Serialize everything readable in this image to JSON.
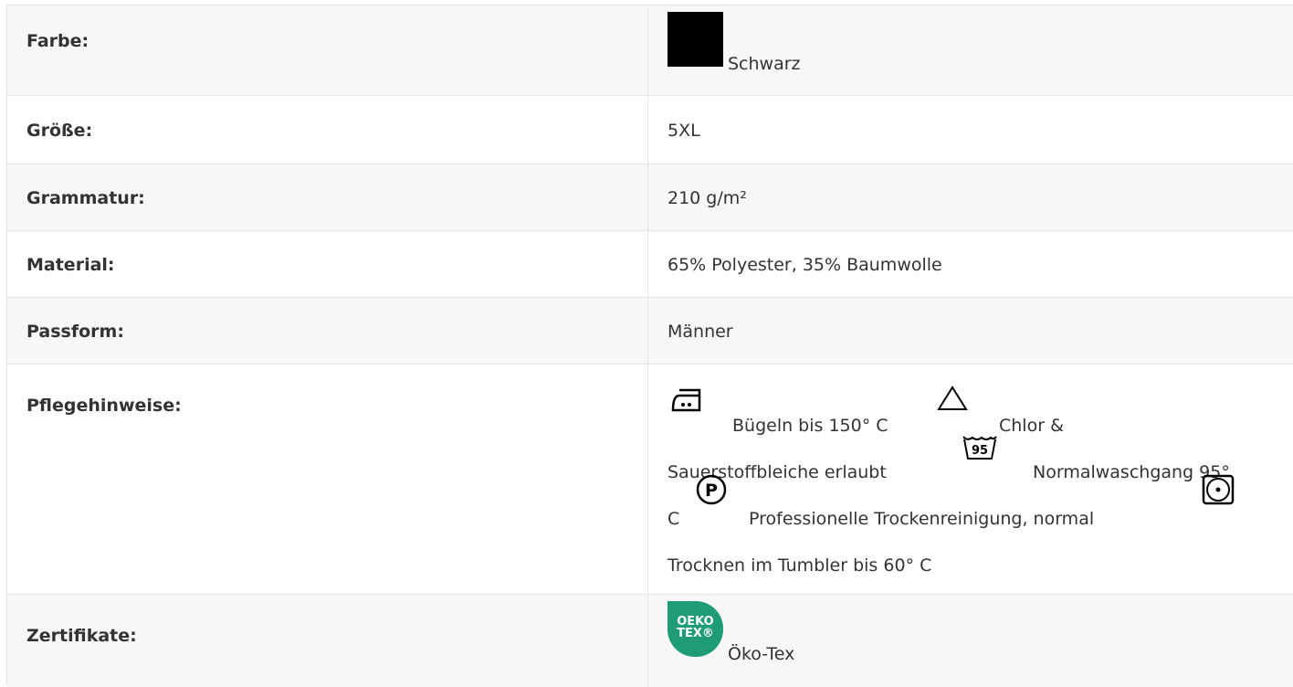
{
  "rows": [
    {
      "label": "Farbe:",
      "value": "Schwarz",
      "swatch_color": "#000000"
    },
    {
      "label": "Größe:",
      "value": "5XL"
    },
    {
      "label": "Grammatur:",
      "value": "210 g/m²"
    },
    {
      "label": "Material:",
      "value": "65% Polyester, 35% Baumwolle"
    },
    {
      "label": "Passform:",
      "value": "Männer"
    },
    {
      "label": "Pflegehinweise:",
      "care": {
        "iron": "Bügeln bis 150° C",
        "bleach_1": "Chlor &",
        "bleach_2": "Sauerstoffbleiche erlaubt",
        "wash": "Normalwaschgang 95°",
        "wash_temp_symbol": "95",
        "wash_end": "C",
        "dryclean_symbol": "P",
        "dryclean": "Professionelle Trockenreinigung, normal",
        "tumble": "Trocknen im Tumbler bis 60° C"
      }
    },
    {
      "label": "Zertifikate:",
      "value": "Öko-Tex",
      "logo_line1": "OEKO",
      "logo_line2": "TEX®",
      "logo_color": "#1f9c77"
    }
  ],
  "icons": [
    "iron-icon",
    "bleach-triangle-icon",
    "wash-95-icon",
    "dryclean-p-icon",
    "tumble-dry-icon",
    "oeko-tex-logo"
  ]
}
